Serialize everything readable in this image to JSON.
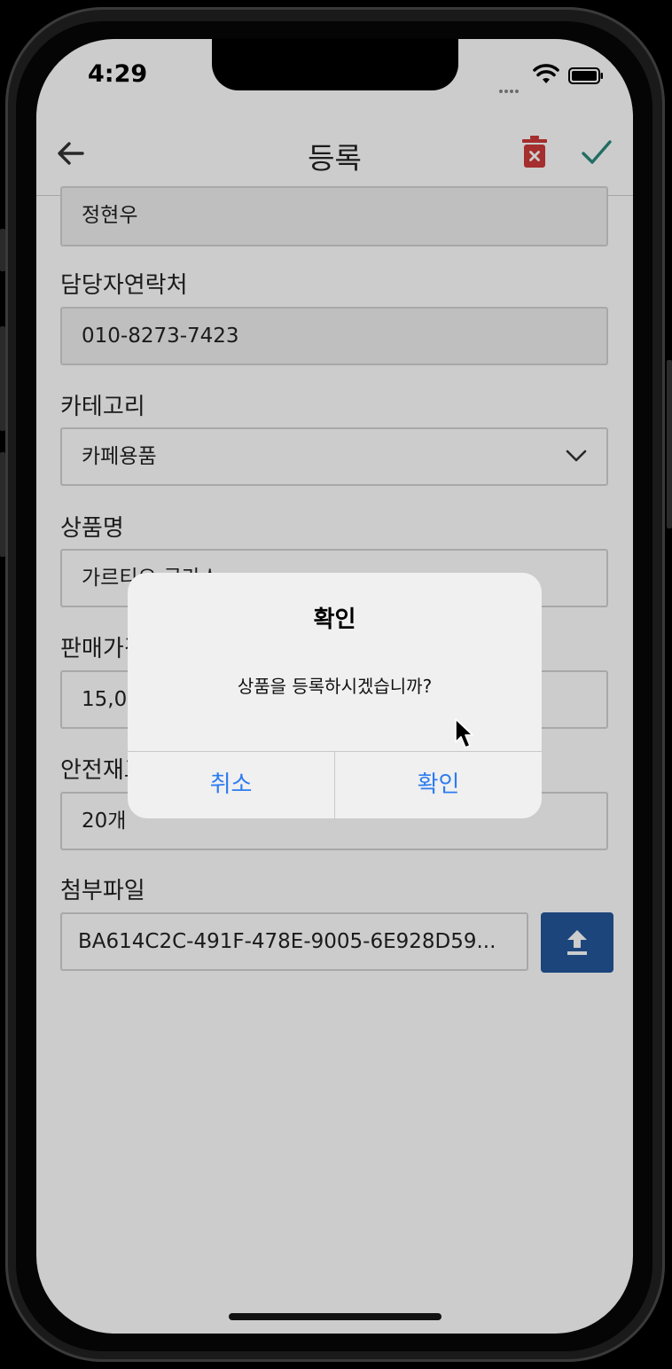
{
  "status_bar": {
    "time": "4:29"
  },
  "header": {
    "title": "등록"
  },
  "form": {
    "manager_name_value": "정현우",
    "contact_label": "담당자연락처",
    "contact_value": "010-8273-7423",
    "category_label": "카테고리",
    "category_value": "카페용품",
    "product_name_label": "상품명",
    "product_name_value": "가르티오 글라스",
    "price_label": "판매가격",
    "price_value": "15,000원",
    "safety_stock_label": "안전재고수량",
    "safety_stock_value": "20개",
    "attachment_label": "첨부파일",
    "attachment_value": "BA614C2C-491F-478E-9005-6E928D59..."
  },
  "dialog": {
    "title": "확인",
    "message": "상품을 등록하시겠습니까?",
    "cancel_label": "취소",
    "confirm_label": "확인"
  },
  "colors": {
    "accent_blue": "#2c7cf0",
    "upload_button": "#24579c",
    "delete_red": "#cf3a3a",
    "check_teal": "#2a8a7e"
  }
}
